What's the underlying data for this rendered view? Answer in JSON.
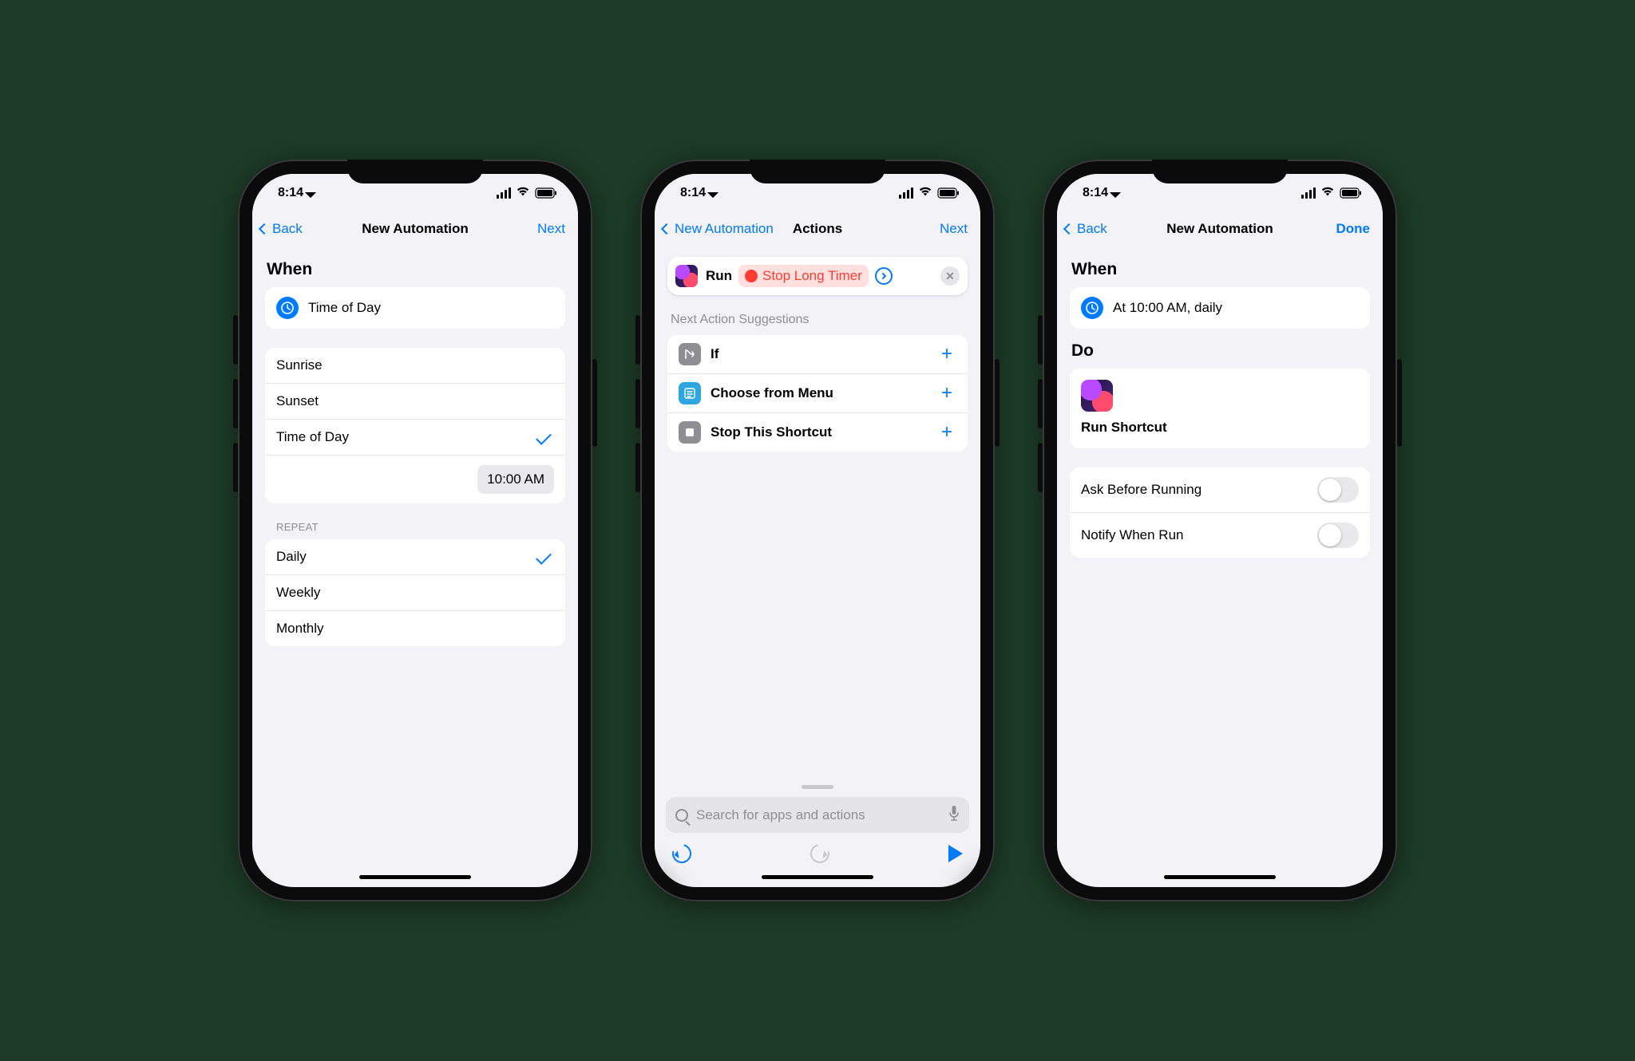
{
  "status": {
    "time": "8:14"
  },
  "screen1": {
    "nav": {
      "back": "Back",
      "title": "New Automation",
      "action": "Next"
    },
    "when_heading": "When",
    "trigger_label": "Time of Day",
    "options": [
      "Sunrise",
      "Sunset",
      "Time of Day"
    ],
    "selected_option_index": 2,
    "time_value": "10:00 AM",
    "repeat_header": "REPEAT",
    "repeat_options": [
      "Daily",
      "Weekly",
      "Monthly"
    ],
    "selected_repeat_index": 0
  },
  "screen2": {
    "nav": {
      "back": "New Automation",
      "title": "Actions",
      "action": "Next"
    },
    "action": {
      "verb": "Run",
      "shortcut_name": "Stop Long Timer"
    },
    "suggestions_header": "Next Action Suggestions",
    "suggestions": [
      "If",
      "Choose from Menu",
      "Stop This Shortcut"
    ],
    "search_placeholder": "Search for apps and actions"
  },
  "screen3": {
    "nav": {
      "back": "Back",
      "title": "New Automation",
      "action": "Done"
    },
    "when_heading": "When",
    "summary": "At 10:00 AM, daily",
    "do_heading": "Do",
    "do_label": "Run Shortcut",
    "settings": [
      "Ask Before Running",
      "Notify When Run"
    ],
    "settings_state": [
      false,
      false
    ]
  }
}
